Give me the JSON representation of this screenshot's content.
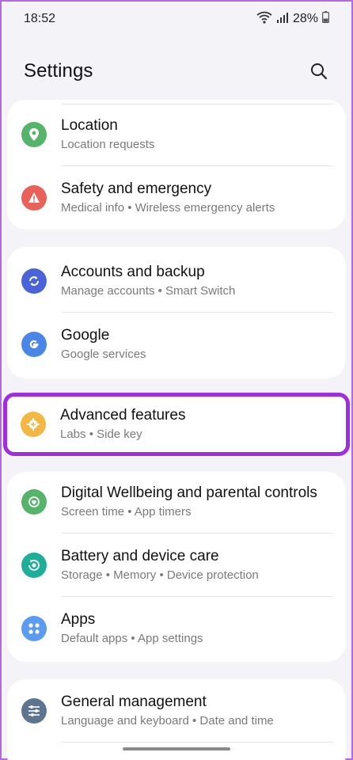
{
  "status": {
    "time": "18:52",
    "battery": "28%"
  },
  "header": {
    "title": "Settings"
  },
  "items": {
    "location": {
      "title": "Location",
      "subtitle": "Location requests",
      "color": "#55b36a"
    },
    "safety": {
      "title": "Safety and emergency",
      "subtitle": "Medical info  •  Wireless emergency alerts",
      "color": "#e8625a"
    },
    "accounts": {
      "title": "Accounts and backup",
      "subtitle": "Manage accounts  •  Smart Switch",
      "color": "#4a63d8"
    },
    "google": {
      "title": "Google",
      "subtitle": "Google services",
      "color": "#4a86e8"
    },
    "advanced": {
      "title": "Advanced features",
      "subtitle": "Labs  •  Side key",
      "color": "#f5b743"
    },
    "wellbeing": {
      "title": "Digital Wellbeing and parental controls",
      "subtitle": "Screen time  •  App timers",
      "color": "#55b36a"
    },
    "battery": {
      "title": "Battery and device care",
      "subtitle": "Storage  •  Memory  •  Device protection",
      "color": "#1fae9a"
    },
    "apps": {
      "title": "Apps",
      "subtitle": "Default apps  •  App settings",
      "color": "#5b9cf2"
    },
    "general": {
      "title": "General management",
      "subtitle": "Language and keyboard  •  Date and time",
      "color": "#5e7590"
    }
  },
  "accent": {
    "highlight_border": "#a02ede"
  }
}
